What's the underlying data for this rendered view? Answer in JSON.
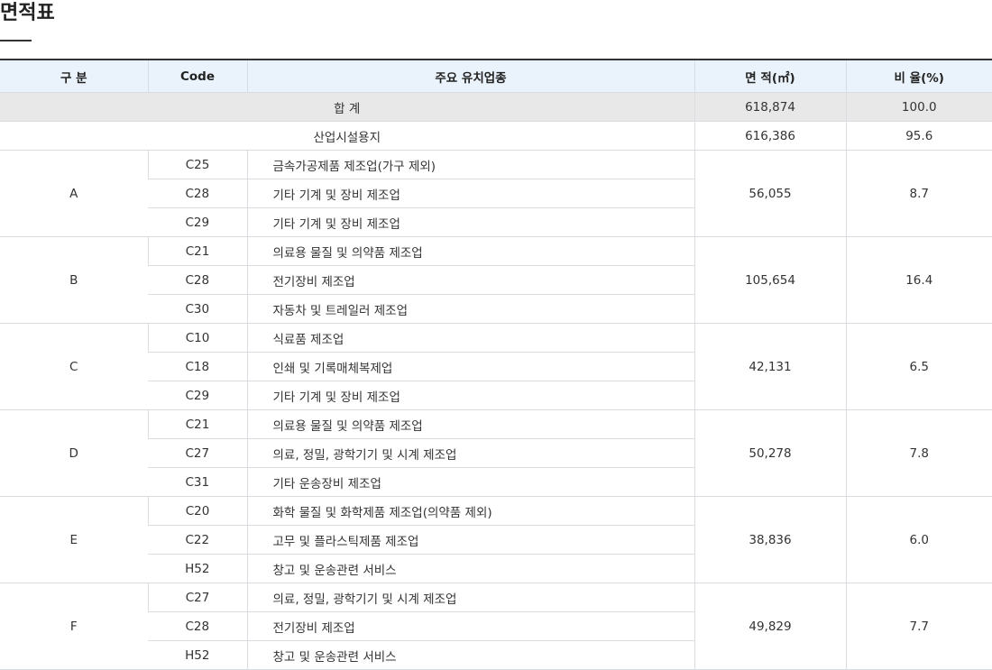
{
  "page_title": "면적표",
  "table": {
    "headers": {
      "group": "구 분",
      "code": "Code",
      "industry": "주요 유치업종",
      "area": "면 적(㎡)",
      "ratio": "비 율(%)"
    },
    "total": {
      "label": "합 계",
      "area": "618,874",
      "ratio": "100.0"
    },
    "industrial": {
      "label": "산업시설용지",
      "area": "616,386",
      "ratio": "95.6"
    },
    "groups": [
      {
        "name": "A",
        "area": "56,055",
        "ratio": "8.7",
        "rows": [
          {
            "code": "C25",
            "industry": "금속가공제품 제조업(가구 제외)"
          },
          {
            "code": "C28",
            "industry": "기타 기계 및 장비 제조업"
          },
          {
            "code": "C29",
            "industry": "기타 기계 및 장비 제조업"
          }
        ]
      },
      {
        "name": "B",
        "area": "105,654",
        "ratio": "16.4",
        "rows": [
          {
            "code": "C21",
            "industry": "의료용 물질 및 의약품 제조업"
          },
          {
            "code": "C28",
            "industry": "전기장비 제조업"
          },
          {
            "code": "C30",
            "industry": "자동차 및 트레일러 제조업"
          }
        ]
      },
      {
        "name": "C",
        "area": "42,131",
        "ratio": "6.5",
        "rows": [
          {
            "code": "C10",
            "industry": "식료품 제조업"
          },
          {
            "code": "C18",
            "industry": "인쇄 및 기록매체복제업"
          },
          {
            "code": "C29",
            "industry": "기타 기계 및 장비 제조업"
          }
        ]
      },
      {
        "name": "D",
        "area": "50,278",
        "ratio": "7.8",
        "rows": [
          {
            "code": "C21",
            "industry": "의료용 물질 및 의약품 제조업"
          },
          {
            "code": "C27",
            "industry": "의료, 정밀, 광학기기 및 시계 제조업"
          },
          {
            "code": "C31",
            "industry": "기타 운송장비 제조업"
          }
        ]
      },
      {
        "name": "E",
        "area": "38,836",
        "ratio": "6.0",
        "rows": [
          {
            "code": "C20",
            "industry": "화학 물질 및 화학제품 제조업(의약품 제외)"
          },
          {
            "code": "C22",
            "industry": "고무 및 플라스틱제품 제조업"
          },
          {
            "code": "H52",
            "industry": "창고 및 운송관련 서비스"
          }
        ]
      },
      {
        "name": "F",
        "area": "49,829",
        "ratio": "7.7",
        "rows": [
          {
            "code": "C27",
            "industry": "의료, 정밀, 광학기기 및 시계 제조업"
          },
          {
            "code": "C28",
            "industry": "전기장비 제조업"
          },
          {
            "code": "H52",
            "industry": "창고 및 운송관련 서비스"
          }
        ]
      }
    ]
  }
}
